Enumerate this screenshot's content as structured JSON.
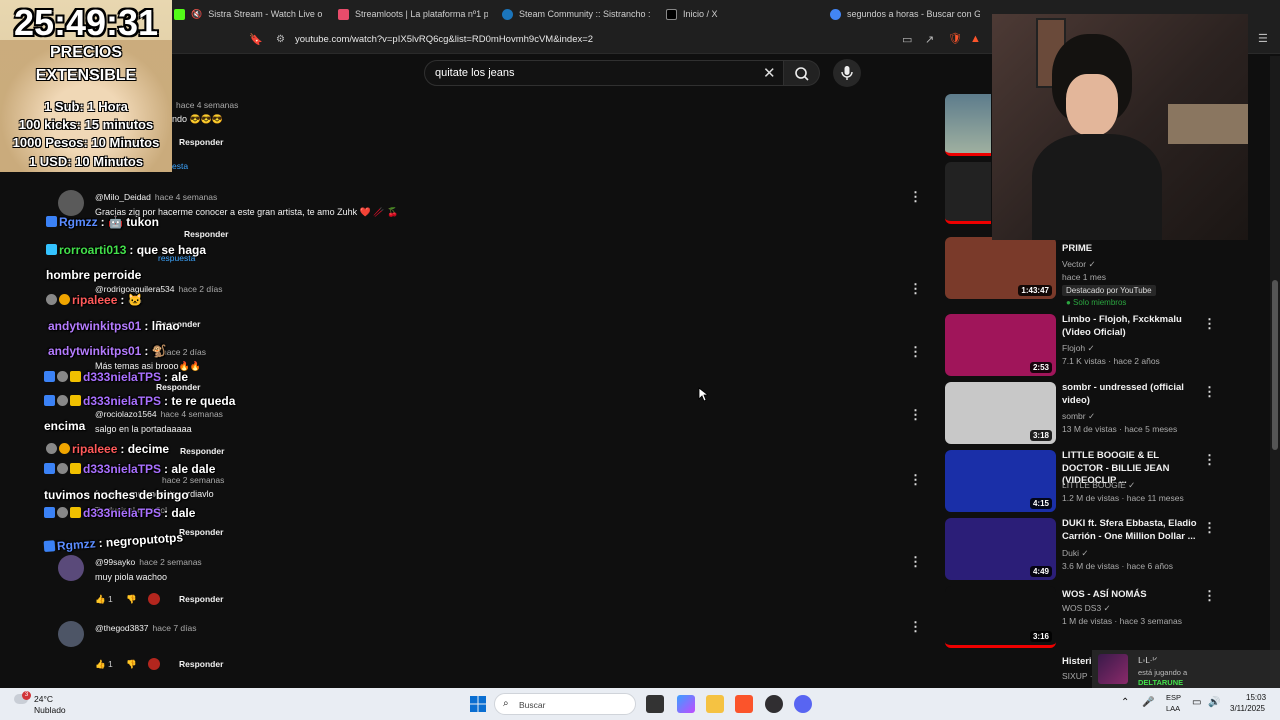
{
  "browser": {
    "tabs": [
      {
        "label": "Sistra Stream - Watch Live on Kic",
        "color": "#53fc18"
      },
      {
        "label": "Streamloots | La plataforma nº1 para",
        "color": "#e84c6b"
      },
      {
        "label": "Steam Community :: Sistrancho :: Item",
        "color": "#1b75bb"
      },
      {
        "label": "Inicio / X",
        "color": "#000000"
      },
      {
        "label": "segundos a horas - Buscar con Goog",
        "color": "#4285f4"
      }
    ],
    "url": "youtube.com/watch?v=pIX5lvRQ6cg&list=RD0mHovmh9cVM&index=2"
  },
  "youtube": {
    "search_value": "quitate los jeans"
  },
  "comments": [
    {
      "author": "",
      "time": "hace 4 semanas",
      "text": "ndo 😎😎😎",
      "reply_label": "Responder",
      "extra": "esta"
    },
    {
      "author": "@Milo_Deidad",
      "time": "hace 4 semanas",
      "text": "Gracias zig por hacerme conocer a este gran artista, te amo Zuhk ❤️ 🥢 🍒",
      "reply_label": "Responder",
      "extra": "respuesta"
    },
    {
      "author": "@rodrigoaguilera534",
      "time": "hace 2 días",
      "text": "",
      "reply_label": "Responder"
    },
    {
      "author": "@rodrigoaguilera534",
      "time": "hace 2 días",
      "text": "Más temas asi brooo🔥🔥",
      "reply_label": "Responder"
    },
    {
      "author": "@rociolazo1564",
      "time": "hace 4 semanas",
      "text": "salgo en la portadaaaaa",
      "reply_label": "Responder"
    },
    {
      "author": "",
      "time": "hace 2 semanas",
      "text": "fuaaaaa me encanta, erdiavlo",
      "translate": "Traducir al español",
      "reply_label": "Responder"
    },
    {
      "author": "@99sayko",
      "time": "hace 2 semanas",
      "text": "muy piola wachoo",
      "likes": "1",
      "reply_label": "Responder"
    },
    {
      "author": "@thegod3837",
      "time": "hace 7 días",
      "text": "",
      "likes": "1",
      "reply_label": "Responder"
    }
  ],
  "chat": [
    {
      "user": "Rgmzz",
      "color": "#5b8cff",
      "msg": ": 🤖 tukon"
    },
    {
      "user": "rorroarti013",
      "color": "#43e04b",
      "msg": ": que se haga"
    },
    {
      "user": "hombre perroide",
      "color": "#ffffff",
      "msg": ""
    },
    {
      "user": "ripaleee",
      "color": "#ff5a5a",
      "msg": ": 🐱"
    },
    {
      "user": "andytwinkitps01",
      "color": "#b57cff",
      "msg": ": lmao"
    },
    {
      "user": "andytwinkitps01",
      "color": "#b57cff",
      "msg": ": 🐒"
    },
    {
      "user": "d333nielaTPS",
      "color": "#a970ff",
      "msg": ": ale"
    },
    {
      "user": "d333nielaTPS",
      "color": "#a970ff",
      "msg": ": te re queda"
    },
    {
      "user": "encima",
      "color": "#ffffff",
      "msg": ""
    },
    {
      "user": "ripaleee",
      "color": "#ff5a5a",
      "msg": ": decime"
    },
    {
      "user": "d333nielaTPS",
      "color": "#a970ff",
      "msg": ": ale dale"
    },
    {
      "user": "tuvimos noches de bingo",
      "color": "#ffffff",
      "msg": ""
    },
    {
      "user": "d333nielaTPS",
      "color": "#a970ff",
      "msg": ": dale"
    },
    {
      "user": "Rgmzz",
      "color": "#5b8cff",
      "msg": ": negroputotps"
    }
  ],
  "sidebar": [
    {
      "title": "PRIME",
      "channel": "Vector ✓",
      "meta": "hace 1 mes",
      "chip1": "Destacado por YouTube",
      "chip2": "● Solo miembros",
      "duration": "1:43:47",
      "thumb": "#7a3a2a"
    },
    {
      "title": "Limbo - Flojoh, Fxckkmalu (Video Oficial)",
      "channel": "Flojoh ✓",
      "meta": "7.1 K vistas · hace 2 años",
      "duration": "2:53",
      "thumb": "#a0155a"
    },
    {
      "title": "sombr - undressed (official video)",
      "channel": "sombr ✓",
      "meta": "13 M de vistas · hace 5 meses",
      "duration": "3:18",
      "thumb": "#c8c8c8"
    },
    {
      "title": "LITTLE BOOGIE & EL DOCTOR - BILLIE JEAN (VIDEOCLIP ...",
      "channel": "LITTLE BOOGIE ✓",
      "meta": "1.2 M de vistas · hace 11 meses",
      "duration": "4:15",
      "thumb": "#1a2fa8"
    },
    {
      "title": "DUKI ft. Sfera Ebbasta, Eladio Carrión - One Million Dollar ...",
      "channel": "Duki ✓",
      "meta": "3.6 M de vistas · hace 6 años",
      "duration": "4:49",
      "thumb": "#2b1e78"
    },
    {
      "title": "WOS - ASÍ NOMÁS",
      "channel": "WOS DS3 ✓",
      "meta": "1 M de vistas · hace 3 semanas",
      "duration": "3:16",
      "thumb": "#0f0f0f"
    },
    {
      "title": "Histeri",
      "channel": "SIXUP ·",
      "meta": "",
      "duration": "",
      "thumb": "#0f0f0f"
    }
  ],
  "overlay": {
    "timer": "25:49:31",
    "lines": [
      "PRECIOS",
      "EXTENSIBLE",
      "1 Sub: 1 Hora",
      "100 kicks: 15 minutos",
      "1000 Pesos: 10 Minutos",
      "1 USD: 10 Minutos"
    ]
  },
  "game_card": {
    "user": "ᒪ◦ᒪ·ᑊᐟ",
    "status": "está jugando a",
    "game": "DELTARUNE"
  },
  "taskbar": {
    "weather_temp": "24°C",
    "weather_desc": "Nublado",
    "search_label": "Buscar",
    "lang": "ESP",
    "lang2": "LAA",
    "time": "15:03",
    "date": "3/11/2025",
    "notif_count": "3"
  }
}
